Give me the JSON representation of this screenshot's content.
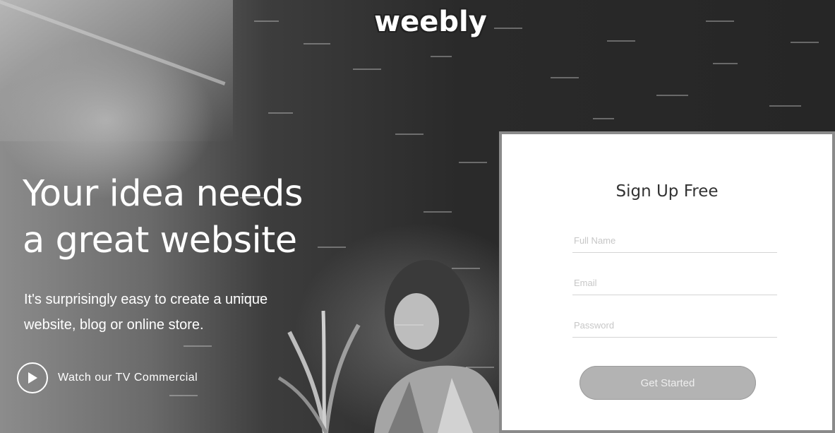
{
  "brand": {
    "logo_text": "weebly"
  },
  "hero": {
    "headline_line1": "Your idea needs",
    "headline_line2": "a great website",
    "subhead_line1": "It's surprisingly easy to create a unique",
    "subhead_line2": "website, blog or online store.",
    "video_link_label": "Watch our TV Commercial"
  },
  "signup": {
    "title": "Sign Up Free",
    "fields": [
      {
        "name": "full-name",
        "placeholder": "Full Name",
        "value": ""
      },
      {
        "name": "email",
        "placeholder": "Email",
        "value": ""
      },
      {
        "name": "password",
        "placeholder": "Password",
        "value": ""
      }
    ],
    "submit_label": "Get Started"
  },
  "icons": {
    "play": "play-icon"
  },
  "colors": {
    "cta_background": "#b3b3b3",
    "panel_border": "#8a8a8a",
    "text_light": "#ffffff"
  }
}
